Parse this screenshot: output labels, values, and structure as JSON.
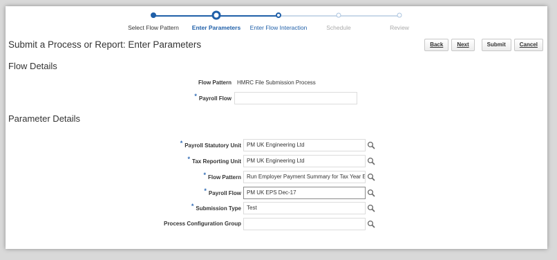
{
  "train": {
    "steps": [
      {
        "label": "Select Flow Pattern",
        "state": "done"
      },
      {
        "label": "Enter Parameters",
        "state": "current"
      },
      {
        "label": "Enter Flow Interaction",
        "state": "next"
      },
      {
        "label": "Schedule",
        "state": "future"
      },
      {
        "label": "Review",
        "state": "future"
      }
    ]
  },
  "page_title": "Submit a Process or Report: Enter Parameters",
  "buttons": {
    "back": "Back",
    "next": "Next",
    "submit": "Submit",
    "cancel": "Cancel"
  },
  "flow_details": {
    "title": "Flow Details",
    "flow_pattern_label": "Flow Pattern",
    "flow_pattern_value": "HMRC File Submission Process",
    "payroll_flow_label": "Payroll Flow",
    "payroll_flow_value": ""
  },
  "parameter_details": {
    "title": "Parameter Details",
    "fields": [
      {
        "label": "Payroll Statutory Unit",
        "value": "PM UK Engineering Ltd",
        "required": true
      },
      {
        "label": "Tax Reporting Unit",
        "value": "PM UK Engineering Ltd",
        "required": true
      },
      {
        "label": "Flow Pattern",
        "value": "Run Employer Payment Summary for Tax Year Ending",
        "required": true
      },
      {
        "label": "Payroll Flow",
        "value": "PM UK EPS Dec-17",
        "required": true
      },
      {
        "label": "Submission Type",
        "value": "Test",
        "required": true
      },
      {
        "label": "Process Configuration Group",
        "value": "",
        "required": false
      }
    ]
  },
  "required_marker": "*",
  "colors": {
    "accent": "#1f5fa8",
    "required": "#2f6ab4",
    "future": "#c8d8e8"
  },
  "icons": {
    "lookup": "search-icon"
  }
}
